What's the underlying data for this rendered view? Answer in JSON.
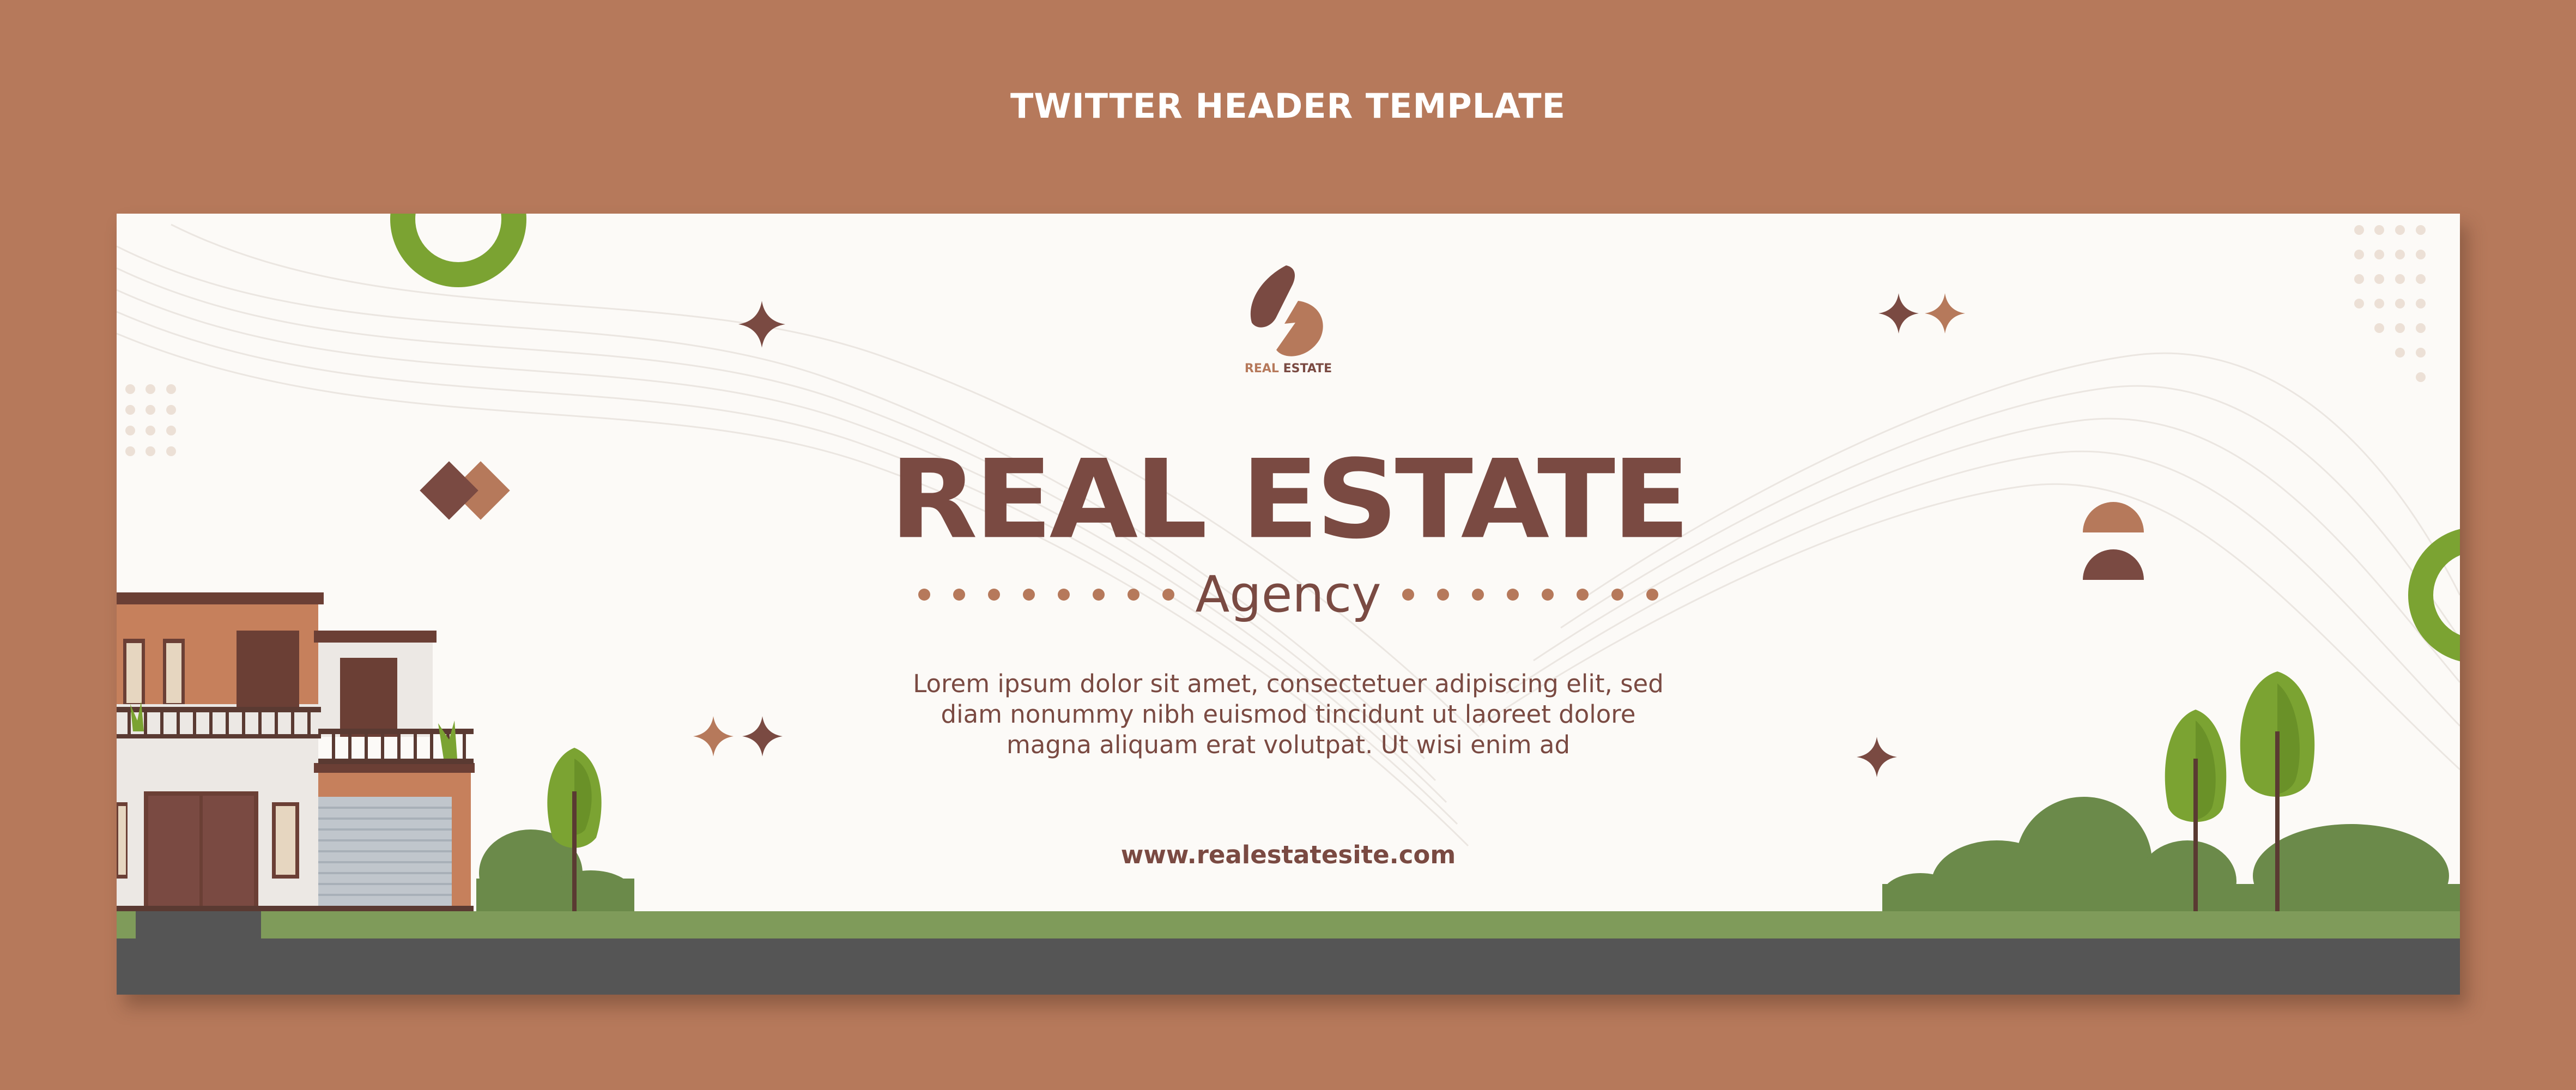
{
  "page_title": "TWITTER HEADER TEMPLATE",
  "banner": {
    "logo": {
      "icon": "real-estate-logo-icon",
      "text_part1": "REAL",
      "text_part2": "ESTATE"
    },
    "headline": "REAL ESTATE",
    "subtitle": "Agency",
    "body_text": "Lorem ipsum dolor sit amet, consectetuer adipiscing elit, sed diam nonummy nibh euismod tincidunt ut laoreet dolore magna aliquam erat volutpat. Ut wisi enim ad",
    "website": "www.realestatesite.com"
  },
  "colors": {
    "page_background": "#b6795b",
    "banner_background": "#fcfaf7",
    "primary_brown": "#7a4a42",
    "accent_tan": "#b6795b",
    "green": "#7ba332",
    "bush_green": "#6b8a4a",
    "grass": "#7f9b5a",
    "road": "#555555"
  }
}
